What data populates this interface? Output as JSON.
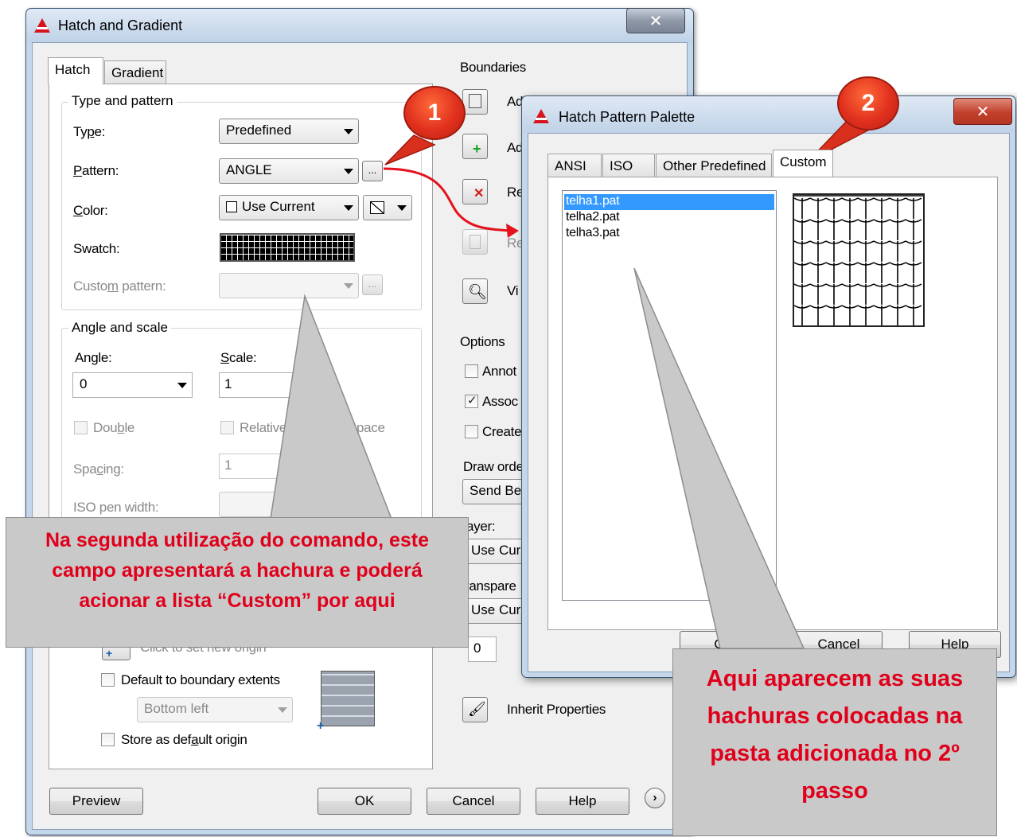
{
  "main_dialog": {
    "title": "Hatch and Gradient",
    "tabs": [
      "Hatch",
      "Gradient"
    ],
    "type_and_pattern": {
      "group_title": "Type and pattern",
      "type_label": "Type:",
      "type_value": "Predefined",
      "pattern_label": "Pattern:",
      "pattern_value": "ANGLE",
      "browse_label": "...",
      "color_label": "Color:",
      "color_value": "Use Current",
      "swatch_label": "Swatch:",
      "custom_pattern_label": "Custom pattern:",
      "custom_pattern_value": ""
    },
    "angle_and_scale": {
      "group_title": "Angle and scale",
      "angle_label": "Angle:",
      "angle_value": "0",
      "scale_label": "Scale:",
      "scale_value": "1",
      "double_label": "Double",
      "relative_label": "Relative",
      "relative_tail": "pace",
      "spacing_label": "Spacing:",
      "spacing_value": "1",
      "iso_pen_label": "ISO pen width:"
    },
    "origin": {
      "click_label": "Click to set new origin",
      "default_extents_label": "Default to boundary extents",
      "position_value": "Bottom left",
      "store_default_label": "Store as default origin"
    },
    "boundaries": {
      "group_title": "Boundaries",
      "add_pick_label": "Add: Pick points",
      "add_select_label": "Ad",
      "remove_label": "Re",
      "recreate_label": "Re",
      "view_label": "Vi"
    },
    "options": {
      "group_title": "Options",
      "annotative_label": "Annot",
      "associative_label": "Assoc",
      "create_label": "Create",
      "draw_order_label": "Draw orde",
      "draw_order_value": "Send Be",
      "layer_label": "ayer:",
      "layer_value": "Use Cur",
      "transparency_label": "ranspare",
      "transparency_value": "Use Cur",
      "transparency_amount": "0"
    },
    "inherit_label": "Inherit Properties",
    "buttons": {
      "preview": "Preview",
      "ok": "OK",
      "cancel": "Cancel",
      "help": "Help"
    }
  },
  "palette_dialog": {
    "title": "Hatch Pattern Palette",
    "tabs": [
      "ANSI",
      "ISO",
      "Other Predefined",
      "Custom"
    ],
    "patterns": [
      "telha1.pat",
      "telha2.pat",
      "telha3.pat"
    ],
    "selected_index": 0,
    "buttons": {
      "ok": "O",
      "cancel": "Cancel",
      "help": "Help"
    }
  },
  "callouts": {
    "marker_1": "1",
    "marker_2": "2",
    "note_left": "Na segunda utilização do comando, este campo apresentará a hachura e poderá acionar a lista “Custom” por aqui",
    "note_right": "Aqui aparecem as suas hachuras colocadas na pasta adicionada no 2º passo"
  },
  "colors": {
    "callout_text": "#e0001b",
    "callout_fill": "#c9c9c9",
    "marker_fill": "#e0301e",
    "selection": "#3399ff",
    "arrow": "#e4121d"
  }
}
